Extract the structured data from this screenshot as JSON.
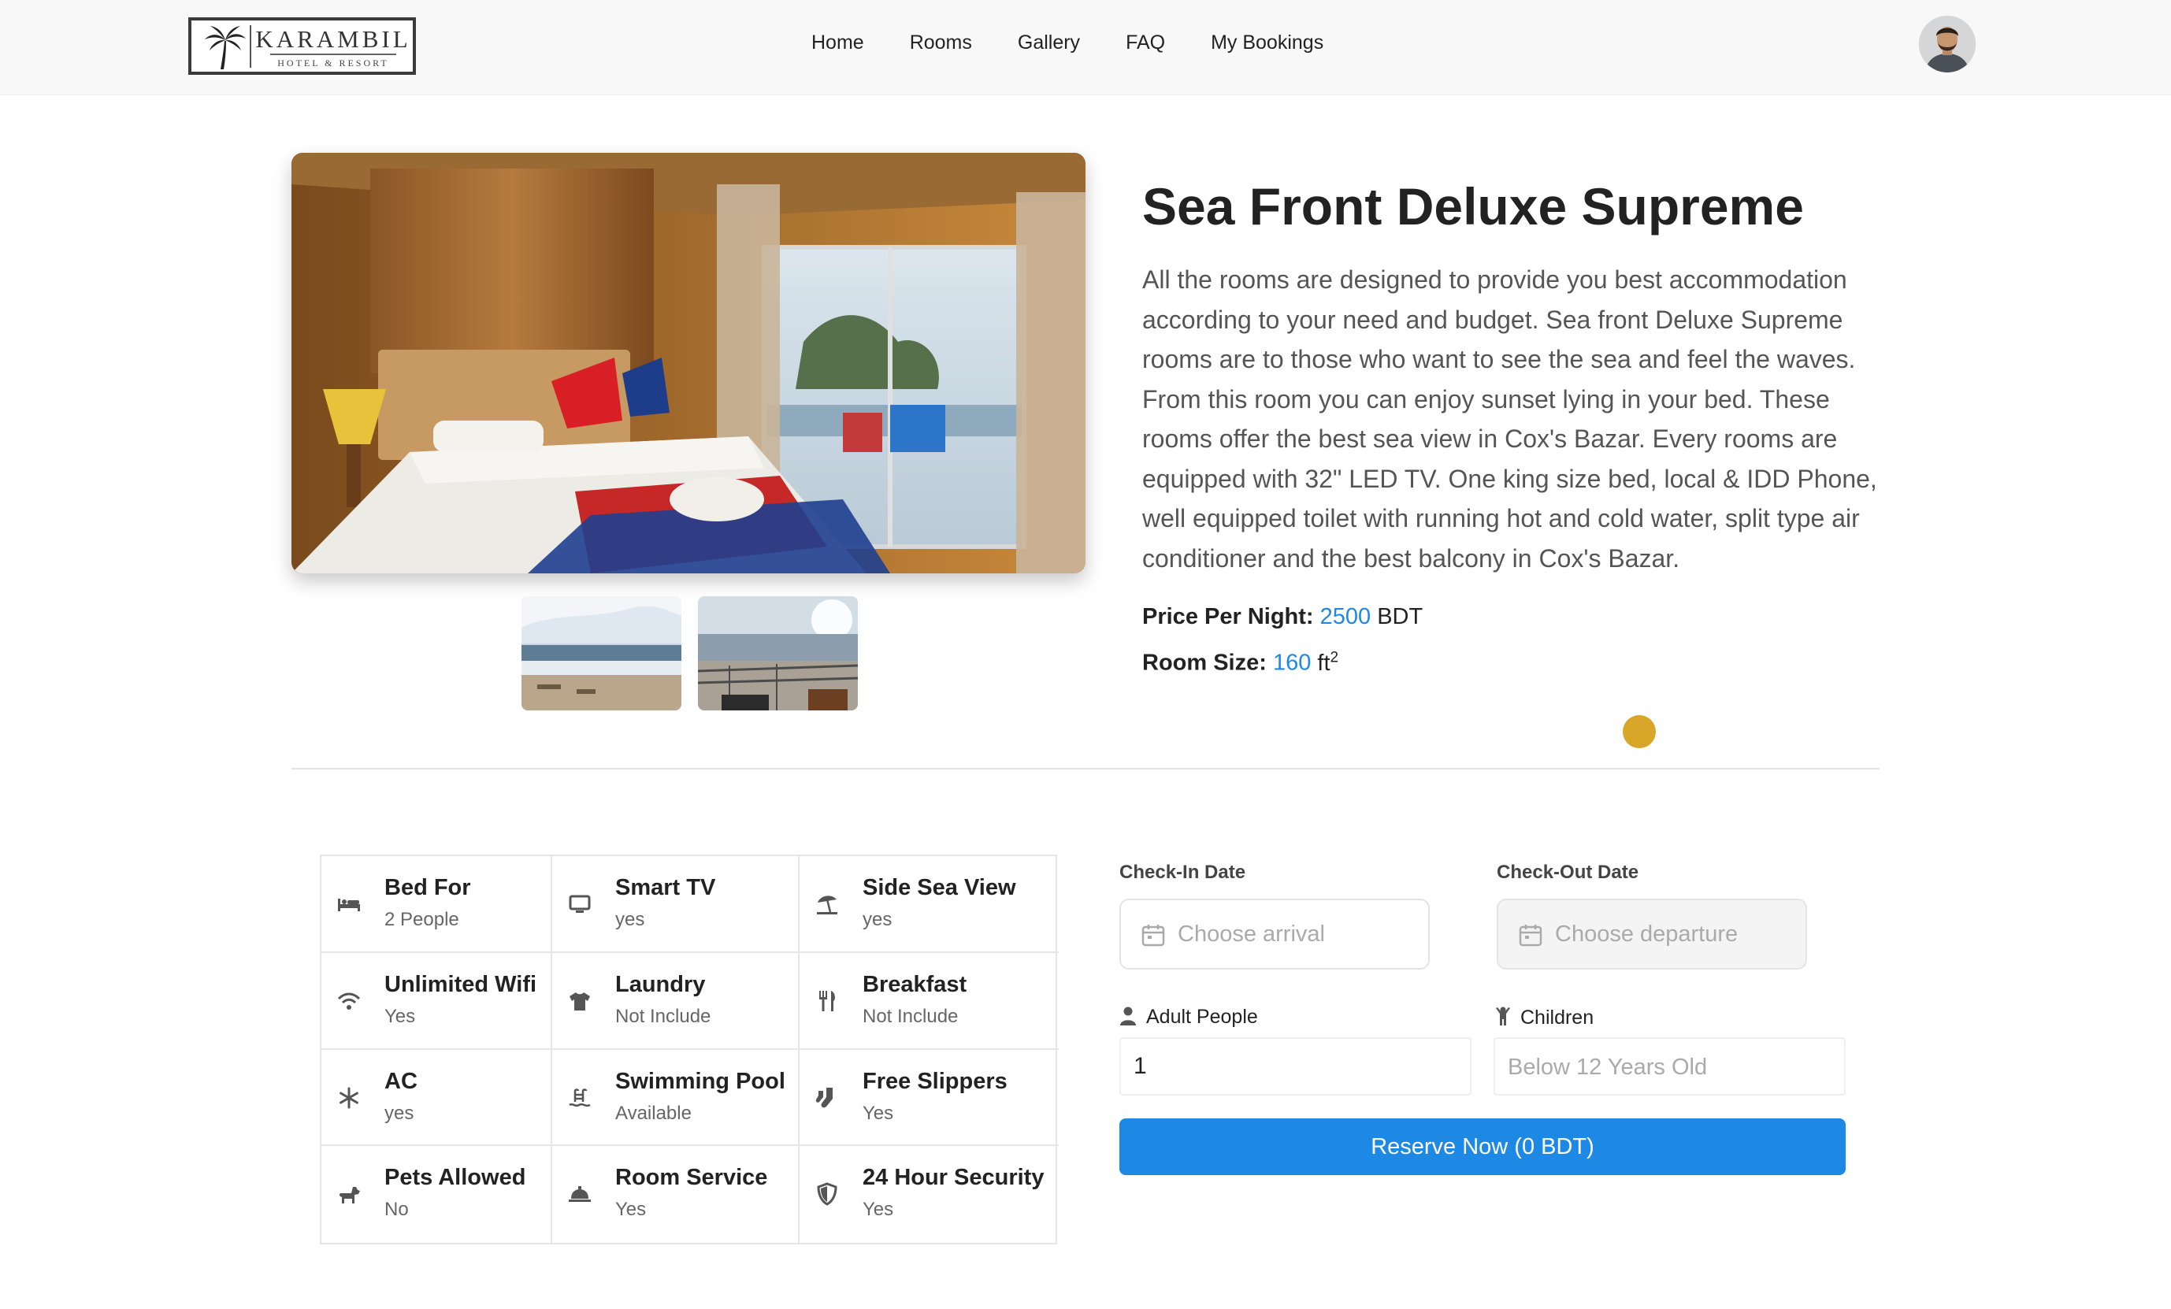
{
  "header": {
    "logo_name": "KARAMBIL",
    "logo_tagline": "HOTEL & RESORT",
    "nav": [
      "Home",
      "Rooms",
      "Gallery",
      "FAQ",
      "My Bookings"
    ]
  },
  "room": {
    "title": "Sea Front Deluxe Supreme",
    "description": "All the rooms are designed to provide you best accommodation according to your need and budget. Sea front Deluxe Supreme rooms are to those who want to see the sea and feel the waves. From this room you can enjoy sunset lying in your bed. These rooms offer the best sea view in Cox's Bazar. Every rooms are equipped with 32\" LED TV. One king size bed, local & IDD Phone, well equipped toilet with running hot and cold water, split type air conditioner and the best balcony in Cox's Bazar.",
    "price_label": "Price Per Night:",
    "price_value": "2500",
    "price_unit": "BDT",
    "size_label": "Room Size:",
    "size_value": "160",
    "size_unit": "ft",
    "size_exp": "2"
  },
  "amenities": [
    {
      "title": "Bed For",
      "value": "2 People",
      "icon": "bed-icon"
    },
    {
      "title": "Smart TV",
      "value": "yes",
      "icon": "tv-icon"
    },
    {
      "title": "Side Sea View",
      "value": "yes",
      "icon": "beach-umbrella-icon"
    },
    {
      "title": "Unlimited Wifi",
      "value": "Yes",
      "icon": "wifi-icon"
    },
    {
      "title": "Laundry",
      "value": "Not Include",
      "icon": "shirt-icon"
    },
    {
      "title": "Breakfast",
      "value": "Not Include",
      "icon": "utensils-icon"
    },
    {
      "title": "AC",
      "value": "yes",
      "icon": "snowflake-icon"
    },
    {
      "title": "Swimming Pool",
      "value": "Available",
      "icon": "pool-icon"
    },
    {
      "title": "Free Slippers",
      "value": "Yes",
      "icon": "socks-icon"
    },
    {
      "title": "Pets Allowed",
      "value": "No",
      "icon": "dog-icon"
    },
    {
      "title": "Room Service",
      "value": "Yes",
      "icon": "service-bell-icon"
    },
    {
      "title": "24 Hour Security",
      "value": "Yes",
      "icon": "shield-icon"
    }
  ],
  "booking": {
    "checkin_label": "Check-In Date",
    "checkin_placeholder": "Choose arrival",
    "checkout_label": "Check-Out Date",
    "checkout_placeholder": "Choose departure",
    "adult_label": "Adult People",
    "adult_value": "1",
    "children_label": "Children",
    "children_placeholder": "Below 12 Years Old",
    "reserve_label": "Reserve Now (0 BDT)"
  },
  "colors": {
    "accent": "#1e88e5",
    "dot": "#d8a629"
  }
}
